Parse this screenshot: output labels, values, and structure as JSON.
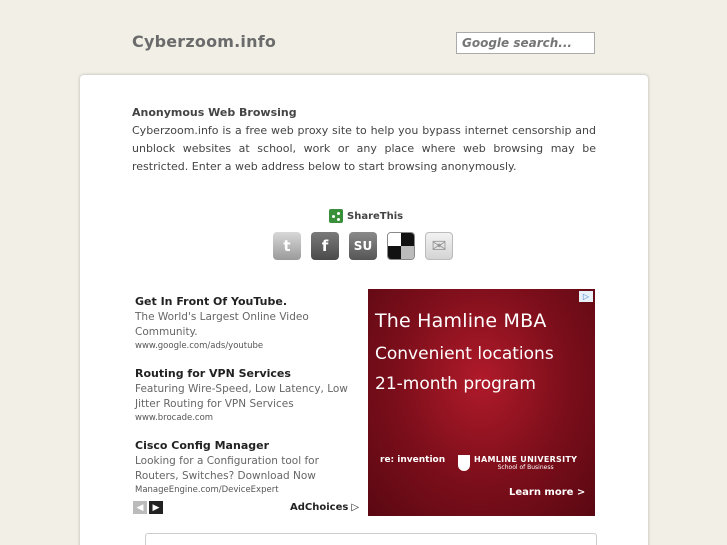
{
  "header": {
    "site_title": "Cyberzoom.info",
    "search_placeholder": "Google search..."
  },
  "intro": {
    "heading": "Anonymous Web Browsing",
    "text": "Cyberzoom.info is a free web proxy site to help you bypass internet censorship and unblock websites at school, work or any place where web browsing may be restricted. Enter a web address below to start browsing anonymously."
  },
  "share": {
    "label": "ShareThis",
    "icons": [
      "twitter-icon",
      "facebook-icon",
      "stumbleupon-icon",
      "delicious-icon",
      "email-icon"
    ],
    "stumble_glyph": "SU"
  },
  "ads": [
    {
      "title": "Get In Front Of YouTube.",
      "desc": "The World's Largest Online Video Community.",
      "url": "www.google.com/ads/youtube"
    },
    {
      "title": "Routing for VPN Services",
      "desc": "Featuring Wire-Speed, Low Latency, Low Jitter Routing for VPN Services",
      "url": "www.brocade.com"
    },
    {
      "title": "Cisco Config Manager",
      "desc": "Looking for a Configuration tool for Routers, Switches? Download Now",
      "url": "ManageEngine.com/DeviceExpert"
    }
  ],
  "adchoices": "AdChoices",
  "banner": {
    "title": "The Hamline MBA",
    "line1": "Convenient locations",
    "line2": "21-month program",
    "tagline": "re: invention",
    "university": "HAMLINE UNIVERSITY",
    "school": "School of Business",
    "cta": "Learn more >"
  },
  "colors": {
    "page_bg": "#f1efe6",
    "banner_red": "#8a1020",
    "sharethis_green": "#3a8f3a"
  }
}
